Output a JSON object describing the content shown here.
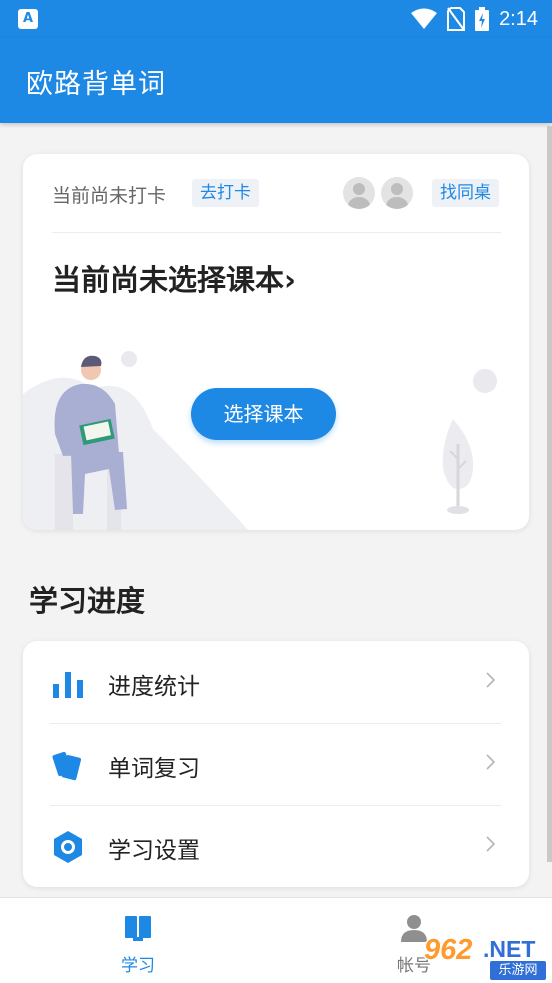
{
  "status_bar": {
    "app_icon_letter": "A",
    "time": "2:14"
  },
  "app_bar": {
    "title": "欧路背单词"
  },
  "checkin_card": {
    "status_text": "当前尚未打卡",
    "checkin_tag": "去打卡",
    "deskmate_tag": "找同桌",
    "book_title": "当前尚未选择课本",
    "book_chevron": "›",
    "select_book_button": "选择课本"
  },
  "progress_section": {
    "title": "学习进度",
    "items": [
      {
        "label": "进度统计",
        "icon": "bar-chart-icon"
      },
      {
        "label": "单词复习",
        "icon": "cards-icon"
      },
      {
        "label": "学习设置",
        "icon": "hexagon-settings-icon"
      }
    ]
  },
  "bottom_nav": {
    "items": [
      {
        "label": "学习",
        "icon": "book-icon",
        "active": true
      },
      {
        "label": "帐号",
        "icon": "person-icon",
        "active": false
      }
    ]
  },
  "watermark": {
    "number": "962",
    "suffix": ".NET",
    "caption": "乐游网"
  },
  "colors": {
    "primary": "#1e88e5",
    "background": "#f3f3f3",
    "card": "#ffffff"
  }
}
